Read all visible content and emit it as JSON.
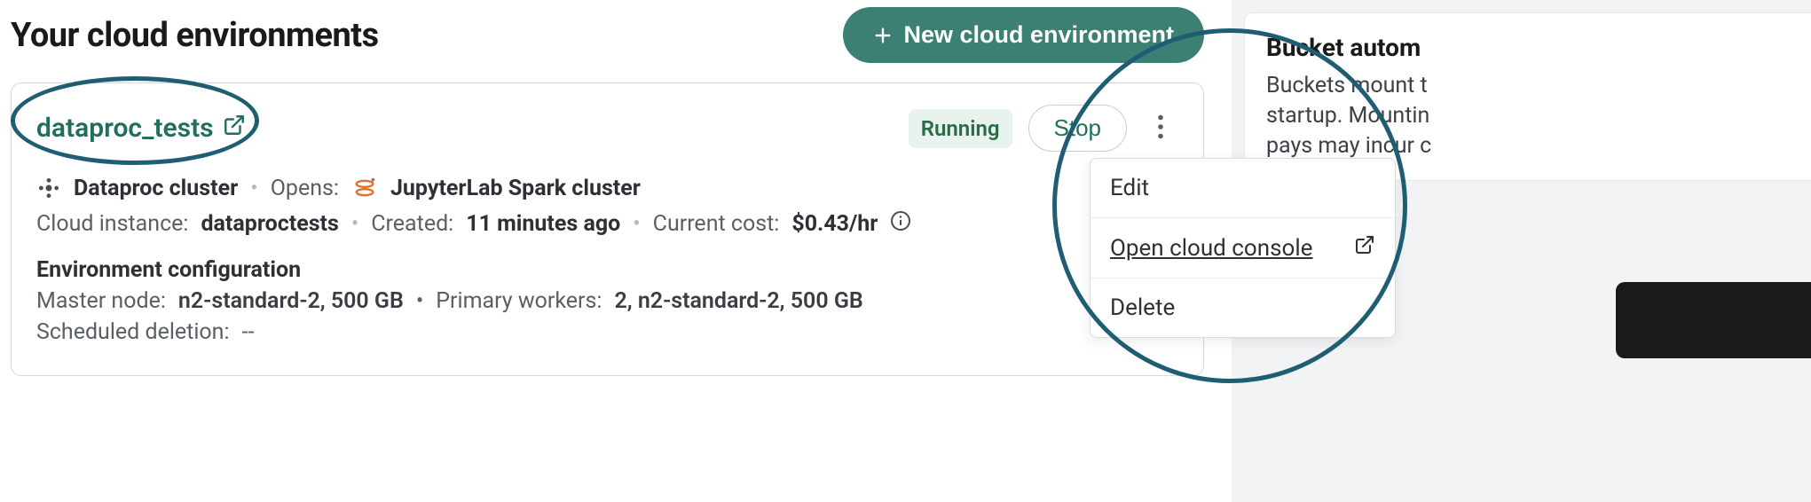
{
  "header": {
    "title": "Your cloud environments",
    "new_btn_label": "New cloud environment"
  },
  "env": {
    "name": "dataproc_tests",
    "status": "Running",
    "stop_label": "Stop",
    "type_label": "Dataproc cluster",
    "opens_prefix": "Opens:",
    "opens_target": "JupyterLab Spark cluster",
    "instance_prefix": "Cloud instance:",
    "instance_name": "dataproctests",
    "created_prefix": "Created:",
    "created_value": "11 minutes ago",
    "cost_prefix": "Current cost:",
    "cost_value": "$0.43/hr",
    "config_heading": "Environment configuration",
    "master_prefix": "Master node:",
    "master_value": "n2-standard-2, 500 GB",
    "workers_prefix": "Primary workers:",
    "workers_value": "2, n2-standard-2, 500 GB",
    "sched_prefix": "Scheduled deletion:",
    "sched_value": "--"
  },
  "menu": {
    "edit": "Edit",
    "open_console": "Open cloud console",
    "delete": "Delete"
  },
  "sidebar": {
    "title": "Bucket autom",
    "line1": "Buckets mount t",
    "line2": "startup. Mountin",
    "line3": "pays may incur c"
  },
  "icons": {
    "plus": "plus-icon",
    "external": "external-link-icon",
    "kebab": "kebab-icon",
    "info": "info-icon",
    "cluster": "cluster-icon",
    "jupyter": "jupyter-icon"
  }
}
